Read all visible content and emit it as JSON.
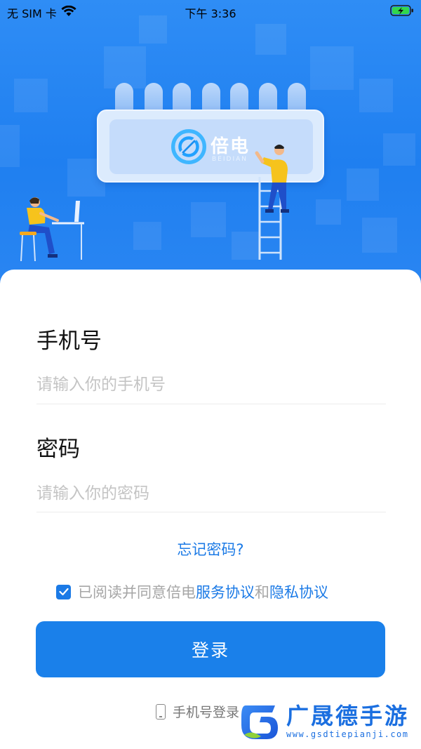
{
  "status_bar": {
    "carrier": "无 SIM 卡",
    "time": "下午 3:36",
    "icons": [
      "wifi-icon",
      "battery-charging-icon"
    ]
  },
  "banner": {
    "brand_name": "倍电",
    "brand_sub": "BEIDIAN"
  },
  "form": {
    "phone_label": "手机号",
    "phone_placeholder": "请输入你的手机号",
    "password_label": "密码",
    "password_placeholder": "请输入你的密码",
    "forgot_password": "忘记密码?",
    "agreement": {
      "checked": true,
      "prefix": "已阅读并同意倍电",
      "service_link": "服务协议",
      "and": "和",
      "privacy_link": "隐私协议"
    },
    "login_button": "登录",
    "alt_login": "手机号登录"
  },
  "watermark": {
    "title": "广晟德手游",
    "url": "www.gsdtiepianji.com"
  },
  "colors": {
    "banner_blue": "#1f7ff0",
    "accent": "#1a80ea",
    "link": "#1b7ae6"
  }
}
